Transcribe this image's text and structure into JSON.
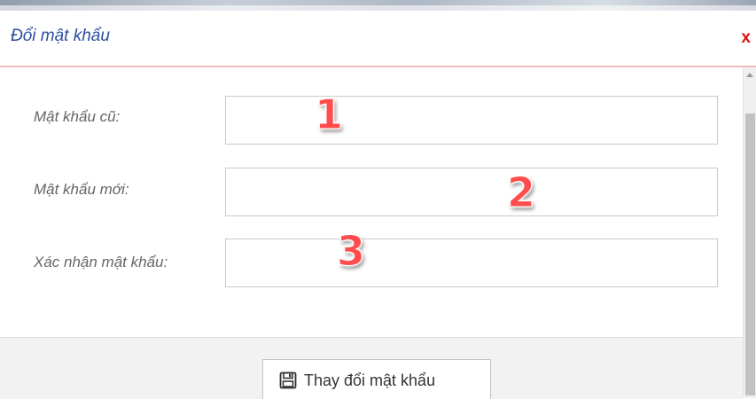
{
  "dialog": {
    "title": "Đổi mật khẩu",
    "close_label": "x"
  },
  "form": {
    "fields": [
      {
        "label": "Mật khẩu cũ:",
        "value": ""
      },
      {
        "label": "Mật khẩu mới:",
        "value": ""
      },
      {
        "label": "Xác nhận mật khẩu:",
        "value": ""
      }
    ]
  },
  "annotations": [
    "1",
    "2",
    "3"
  ],
  "footer": {
    "submit_label": "Thay đổi mật khẩu",
    "submit_icon": "save-icon"
  },
  "colors": {
    "title": "#2d4ea0",
    "close": "#e01010",
    "annotation": "#ff4d4d",
    "header_border": "#f3b9b9"
  }
}
